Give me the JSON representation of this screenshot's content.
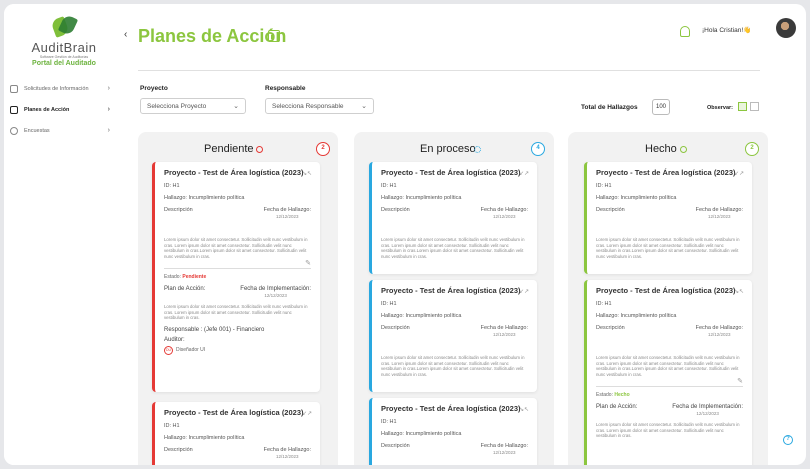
{
  "sidebar": {
    "logo_name": "AuditBrain",
    "logo_sub": "Software Gestión de Auditorías",
    "portal": "Portal del Auditado",
    "items": [
      {
        "label": "Solicitudes de Información"
      },
      {
        "label": "Planes de Acción"
      },
      {
        "label": "Encuestas"
      }
    ]
  },
  "header": {
    "back": "‹",
    "title": "Planes de Acción",
    "greeting": "¡Hola Cristian!👋"
  },
  "filters": {
    "proyecto_label": "Proyecto",
    "proyecto_placeholder": "Selecciona Proyecto",
    "responsable_label": "Responsable",
    "responsable_placeholder": "Selecciona Responsable",
    "total_label": "Total de Hallazgos",
    "total_value": "100",
    "observar": "Observar:"
  },
  "columns": [
    {
      "title": "Pendiente",
      "count": "2",
      "color": "#e53935"
    },
    {
      "title": "En proceso",
      "count": "4",
      "color": "#29a8e0"
    },
    {
      "title": "Hecho",
      "count": "2",
      "color": "#8cc63f"
    }
  ],
  "card": {
    "title": "Proyecto - Test de Área logística (2023)",
    "id": "ID: H1",
    "hallazgo": "Hallazgo: Incumplimiento política",
    "descripcion": "Descripción",
    "fecha_label": "Fecha de Hallazgo:",
    "fecha": "12/12/2023",
    "lorem": "Lorem ipsum dolor sit amet consectetur. Sollicitudin velit nunc vestibulum in cras. Lorem ipsum dolor sit amet consectetur. Sollicitudin velit nunc vestibulum in cras.Lorem ipsum dolor sit amet consectetur. Sollicitudin velit nunc vestibulum in cras.",
    "estado_label": "Estado:",
    "estado_pendiente": "Pendiente",
    "estado_hecho": "Hecho",
    "plan_label": "Plan de Acción:",
    "fecha_impl_label": "Fecha de Implementación:",
    "fecha_impl": "12/12/2023",
    "plan_lorem": "Lorem ipsum dolor sit amet consectetur. Sollicitudin velit nunc vestibulum in cras. Lorem ipsum dolor sit amet consectetur. Sollicitudin velit nunc vestibulum in cras.",
    "responsable": "Responsable : (Jefe 001) - Financiero",
    "auditor": "Auditor:",
    "auditor_badge": "DU",
    "auditor_name": "Diseñador UI"
  }
}
